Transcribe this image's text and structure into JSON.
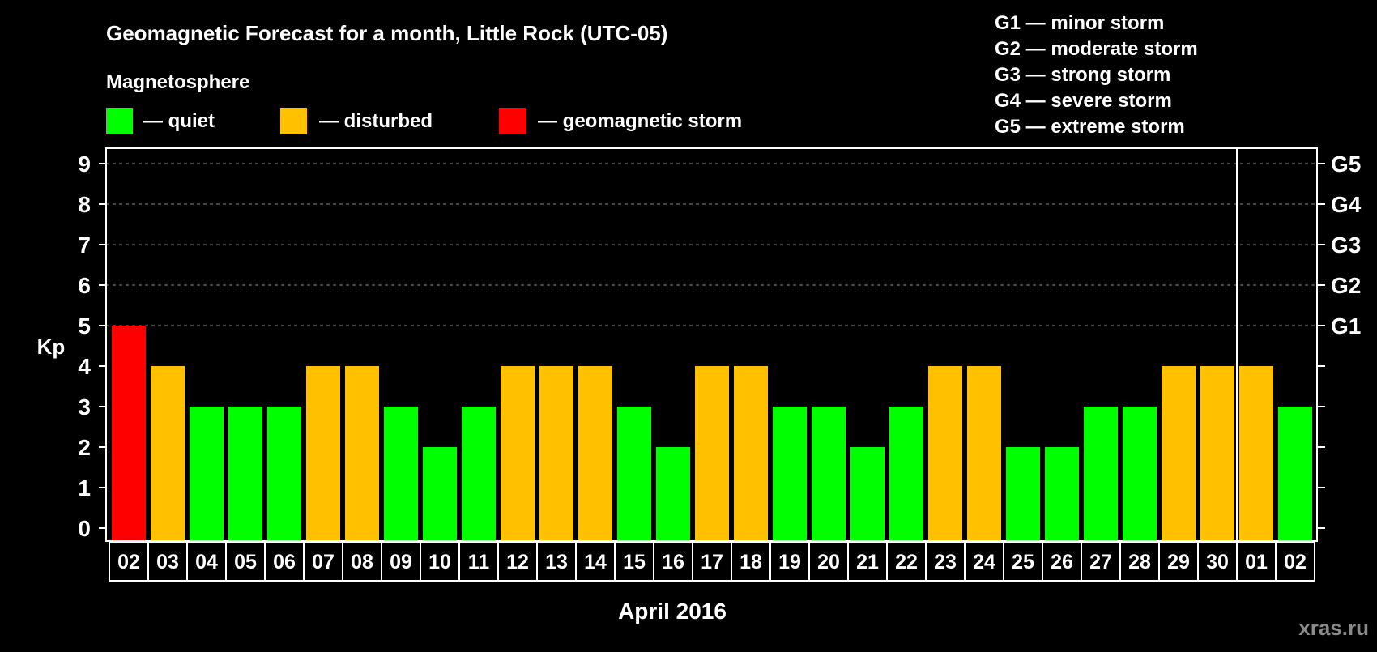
{
  "chart_data": {
    "type": "bar",
    "title": "Geomagnetic Forecast for a month, Little Rock (UTC-05)",
    "subtitle": "Magnetosphere",
    "xlabel": "April 2016",
    "ylabel": "Kp",
    "ylim": [
      0,
      9
    ],
    "yticks": [
      "0",
      "1",
      "2",
      "3",
      "4",
      "5",
      "6",
      "7",
      "8",
      "9"
    ],
    "right_ticks": [
      {
        "value": 5,
        "label": "G1"
      },
      {
        "value": 6,
        "label": "G2"
      },
      {
        "value": 7,
        "label": "G3"
      },
      {
        "value": 8,
        "label": "G4"
      },
      {
        "value": 9,
        "label": "G5"
      }
    ],
    "grid": "dashed horizontal at Kp 5-9",
    "categories": [
      "02",
      "03",
      "04",
      "05",
      "06",
      "07",
      "08",
      "09",
      "10",
      "11",
      "12",
      "13",
      "14",
      "15",
      "16",
      "17",
      "18",
      "19",
      "20",
      "21",
      "22",
      "23",
      "24",
      "25",
      "26",
      "27",
      "28",
      "29",
      "30",
      "01",
      "02"
    ],
    "values": [
      5,
      4,
      3,
      3,
      3,
      4,
      4,
      3,
      2,
      3,
      4,
      4,
      4,
      3,
      2,
      4,
      4,
      3,
      3,
      2,
      3,
      4,
      4,
      2,
      2,
      3,
      3,
      4,
      4,
      4,
      3
    ],
    "month_divider_before_index": 29,
    "legend": [
      {
        "label": "— quiet",
        "color": "#00ff00"
      },
      {
        "label": "— disturbed",
        "color": "#ffc000"
      },
      {
        "label": "— geomagnetic storm",
        "color": "#ff0000"
      }
    ],
    "storm_scale": [
      "G1 — minor storm",
      "G2 — moderate storm",
      "G3 — strong storm",
      "G4 — severe storm",
      "G5 — extreme storm"
    ],
    "watermark": "xras.ru"
  }
}
